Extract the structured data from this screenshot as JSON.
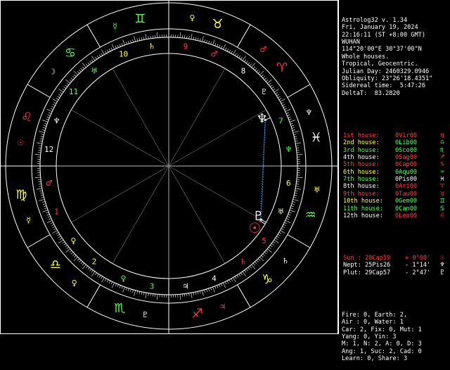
{
  "header": [
    "Astrolog32 v. 1.34",
    "Fri, January 19, 2024",
    "22:16:11 (ST +8:00 GMT)",
    "WUHAN",
    "114°20'00\"E 30°37'00\"N",
    "Whole houses.",
    "Tropical, Geocentric.",
    "Julian Day: 2460329.0946",
    "Obliquity: 23°26'18.4351\"",
    "Sidereal time:  5:47:26",
    "DeltaT:  83.2820"
  ],
  "houses": [
    {
      "name": "1st house:",
      "value": "0Vir00",
      "glyph": "♍",
      "color": "#ff3b3b"
    },
    {
      "name": "2nd house:",
      "value": "0Lib00",
      "glyph": "♎",
      "color": "#ffff55"
    },
    {
      "name": "3rd house:",
      "value": "0Sco00",
      "glyph": "♏",
      "color": "#55ff55"
    },
    {
      "name": "4th house:",
      "value": "0Sag00",
      "glyph": "♐",
      "color": "#ffffff"
    },
    {
      "name": "5th house:",
      "value": "0Cap00",
      "glyph": "♑",
      "color": "#ff3b3b"
    },
    {
      "name": "6th house:",
      "value": "0Aqu00",
      "glyph": "♒",
      "color": "#ffff55"
    },
    {
      "name": "7th house:",
      "value": "0Pis00",
      "glyph": "♓",
      "color": "#55ff55"
    },
    {
      "name": "8th house:",
      "value": "0Ari00",
      "glyph": "♈",
      "color": "#ffffff"
    },
    {
      "name": "9th house:",
      "value": "0Tau00",
      "glyph": "♉",
      "color": "#ff3b3b"
    },
    {
      "name": "10th house:",
      "value": "0Gem00",
      "glyph": "♊",
      "color": "#ffff55"
    },
    {
      "name": "11th house:",
      "value": "0Can00",
      "glyph": "♋",
      "color": "#55ff55"
    },
    {
      "name": "12th house:",
      "value": "0Leo00",
      "glyph": "♌",
      "color": "#ffffff"
    }
  ],
  "house_value_colors": [
    "#ff3b3b",
    "#55ff55",
    "#55ff55",
    "#ff3b3b",
    "#ff3b3b",
    "#55ff55",
    "#ffffff",
    "#ff3b3b",
    "#ff3b3b",
    "#55ff55",
    "#55ff55",
    "#ff3b3b"
  ],
  "planets": [
    {
      "name": "Sun :",
      "value": "28Cap59",
      "aspect": "+ 0°00'",
      "glyph": "☉",
      "color": "#ff3b3b"
    },
    {
      "name": "Nept:",
      "value": "25Pis26",
      "aspect": "- 1°14'",
      "glyph": "♆",
      "color": "#ffffff"
    },
    {
      "name": "Plut:",
      "value": "29Cap57",
      "aspect": "- 2°47'",
      "glyph": "♇",
      "color": "#ffffff"
    }
  ],
  "stats": [
    "Fire: 0, Earth: 2,",
    "Air : 0, Water: 1",
    "Car: 2, Fix: 0, Mut: 1",
    "Yang: 0, Yin: 3",
    "M: 1, N: 2, A: 0, D: 3",
    "Ang: 1, Suc: 2, Cad: 0",
    "Learn: 0, Share: 3"
  ],
  "wheel": {
    "asc_sign_index": 5,
    "signs": [
      {
        "glyph": "♈",
        "color": "#ff3b3b"
      },
      {
        "glyph": "♉",
        "color": "#ffff55"
      },
      {
        "glyph": "♊",
        "color": "#55ff55"
      },
      {
        "glyph": "♋",
        "color": "#55ff55"
      },
      {
        "glyph": "♌",
        "color": "#ff3b3b"
      },
      {
        "glyph": "♍",
        "color": "#ffff55"
      },
      {
        "glyph": "♎",
        "color": "#ffff55"
      },
      {
        "glyph": "♏",
        "color": "#55ff55"
      },
      {
        "glyph": "♐",
        "color": "#ff3b3b"
      },
      {
        "glyph": "♑",
        "color": "#ffff55"
      },
      {
        "glyph": "♒",
        "color": "#55ff55"
      },
      {
        "glyph": "♓",
        "color": "#ffffff"
      }
    ],
    "rulers": [
      {
        "glyph": "♂",
        "color": "#ff3b3b"
      },
      {
        "glyph": "♀",
        "color": "#ffff55"
      },
      {
        "glyph": "☿",
        "color": "#55ff55"
      },
      {
        "glyph": "☽",
        "color": "#ffffff"
      },
      {
        "glyph": "☉",
        "color": "#ff3b3b"
      },
      {
        "glyph": "☿",
        "color": "#ffff55"
      },
      {
        "glyph": "♀",
        "color": "#ffff55"
      },
      {
        "glyph": "♇",
        "color": "#ffffff"
      },
      {
        "glyph": "♃",
        "color": "#ff3b3b"
      },
      {
        "glyph": "♄",
        "color": "#ffffff"
      },
      {
        "glyph": "♅",
        "color": "#ffff55"
      },
      {
        "glyph": "♆",
        "color": "#ffffff"
      }
    ],
    "house_numbers": [
      {
        "label": "1",
        "color": "#ff3b3b"
      },
      {
        "label": "2",
        "color": "#ffff55"
      },
      {
        "label": "3",
        "color": "#55ff55"
      },
      {
        "label": "4",
        "color": "#ffffff"
      },
      {
        "label": "5",
        "color": "#ff3b3b"
      },
      {
        "label": "6",
        "color": "#ffff55"
      },
      {
        "label": "7",
        "color": "#55ff55"
      },
      {
        "label": "8",
        "color": "#ffffff"
      },
      {
        "label": "9",
        "color": "#ff3b3b"
      },
      {
        "label": "10",
        "color": "#ffff55"
      },
      {
        "label": "11",
        "color": "#55ff55"
      },
      {
        "label": "12",
        "color": "#ffffff"
      }
    ],
    "house_cusp_rulers": [
      {
        "glyph": "♂",
        "color": "#ff3b3b"
      },
      {
        "glyph": "♀",
        "color": "#ffff55"
      },
      {
        "glyph": "♀",
        "color": "#55ff55"
      },
      {
        "glyph": "♃",
        "color": "#ffffff"
      },
      {
        "glyph": "♄",
        "color": "#ff3b3b"
      },
      {
        "glyph": "♅",
        "color": "#ffff55"
      },
      {
        "glyph": "♆",
        "color": "#55ff55"
      },
      {
        "glyph": "♇",
        "color": "#ffffff"
      },
      {
        "glyph": "♂",
        "color": "#ff3b3b"
      },
      {
        "glyph": "♄",
        "color": "#ffff55"
      },
      {
        "glyph": "♅",
        "color": "#55ff55"
      },
      {
        "glyph": "♆",
        "color": "#ffffff"
      }
    ],
    "planet_positions": [
      {
        "glyph": "☉",
        "longitude": 298.98,
        "color": "#ff3b3b"
      },
      {
        "glyph": "♆",
        "longitude": 355.43,
        "color": "#ffffff"
      },
      {
        "glyph": "♇",
        "longitude": 299.95,
        "color": "#ffffff"
      }
    ],
    "aspect_color": "#4aa0ff"
  }
}
